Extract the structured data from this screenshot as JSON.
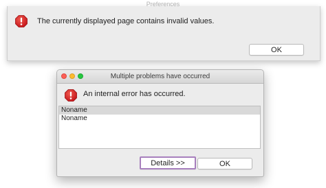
{
  "background_window": {
    "title": "Preferences",
    "message": "The currently displayed page contains invalid values.",
    "ok_label": "OK"
  },
  "dialog": {
    "title": "Multiple problems have occurred",
    "message": "An internal error has occurred.",
    "problems": [
      {
        "label": "Noname",
        "selected": true
      },
      {
        "label": "Noname",
        "selected": false
      }
    ],
    "details_label": "Details >>",
    "ok_label": "OK"
  },
  "colors": {
    "alert_red": "#d21f1f",
    "close_light": "#fc5f57",
    "minimize_light": "#fdbc2e",
    "zoom_light": "#27c840",
    "focus_ring": "#a77fbd"
  },
  "icons": {
    "error": "error-icon",
    "window_controls": [
      "close-window-icon",
      "minimize-window-icon",
      "zoom-window-icon"
    ]
  }
}
